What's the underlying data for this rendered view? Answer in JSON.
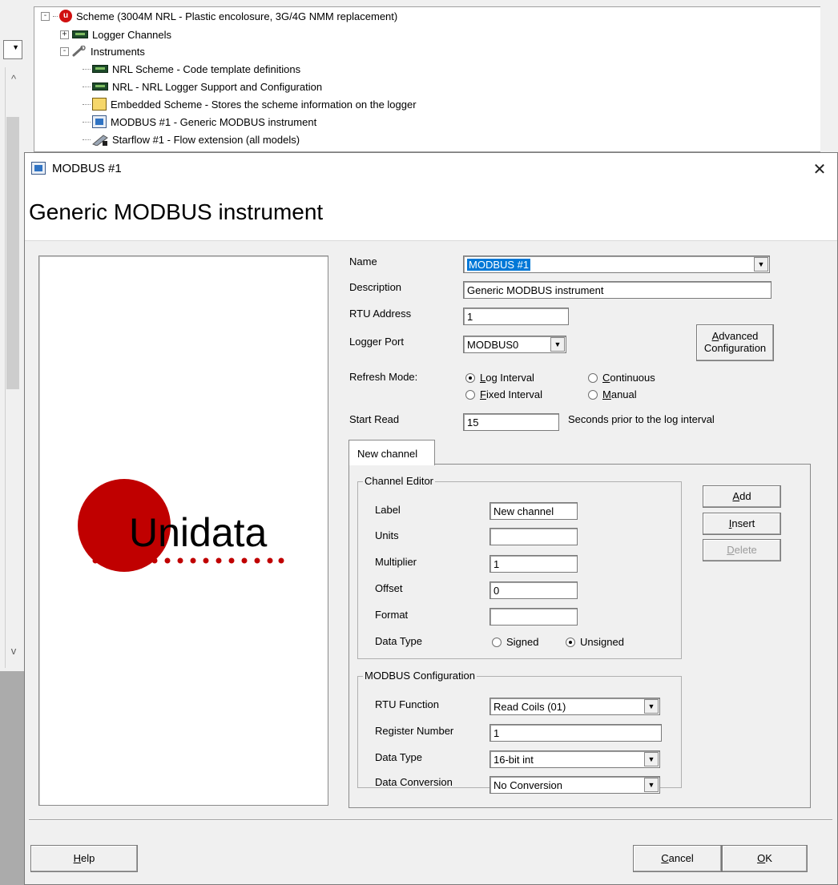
{
  "tree": {
    "root": "Scheme (3004M NRL - Plastic encolosure, 3G/4G NMM replacement)",
    "children": [
      {
        "label": "Logger Channels",
        "expander": "+"
      },
      {
        "label": "Instruments",
        "expander": "-"
      }
    ],
    "instruments": [
      "NRL Scheme - Code template definitions",
      "NRL - NRL Logger Support and Configuration",
      "Embedded Scheme - Stores the scheme information on the logger",
      "MODBUS #1 - Generic MODBUS instrument",
      "Starflow #1 - Flow extension (all models)"
    ],
    "root_icon_letter": "u"
  },
  "dialog": {
    "title": "MODBUS #1",
    "close_glyph": "✕",
    "heading": "Generic MODBUS instrument",
    "logo": {
      "text": "Unidata",
      "accent_color": "#c00000"
    },
    "fields": {
      "name_label": "Name",
      "name_value": "MODBUS #1",
      "description_label": "Description",
      "description_value": "Generic MODBUS instrument",
      "rtu_address_label": "RTU Address",
      "rtu_address_value": "1",
      "logger_port_label": "Logger Port",
      "logger_port_value": "MODBUS0",
      "refresh_mode_label": "Refresh Mode:",
      "start_read_label": "Start Read",
      "start_read_value": "15",
      "start_read_suffix": "Seconds prior to the log interval"
    },
    "advanced_button": {
      "line1_pre": "",
      "line1_u": "A",
      "line1_post": "dvanced",
      "line2": "Configuration"
    },
    "refresh_modes": {
      "log_interval": {
        "pre": "",
        "u": "L",
        "post": "og Interval",
        "selected": true
      },
      "continuous": {
        "pre": "",
        "u": "C",
        "post": "ontinuous",
        "selected": false
      },
      "fixed_interval": {
        "pre": "",
        "u": "F",
        "post": "ixed Interval",
        "selected": false
      },
      "manual": {
        "pre": "",
        "u": "M",
        "post": "anual",
        "selected": false
      }
    },
    "tab_label": "New channel",
    "channel_editor": {
      "title": "Channel Editor",
      "label_label": "Label",
      "label_value": "New channel",
      "units_label": "Units",
      "units_value": "",
      "multiplier_label": "Multiplier",
      "multiplier_value": "1",
      "offset_label": "Offset",
      "offset_value": "0",
      "format_label": "Format",
      "format_value": "",
      "data_type_label": "Data Type",
      "signed_label": "Signed",
      "unsigned_label": "Unsigned",
      "data_type_selected": "Unsigned"
    },
    "side_buttons": {
      "add": {
        "u": "A",
        "post": "dd"
      },
      "insert": {
        "u": "I",
        "post": "nsert"
      },
      "delete": {
        "u": "D",
        "post": "elete",
        "disabled": true
      }
    },
    "modbus_config": {
      "title": "MODBUS Configuration",
      "rtu_function_label": "RTU Function",
      "rtu_function_value": "Read Coils (01)",
      "register_number_label": "Register Number",
      "register_number_value": "1",
      "data_type_label": "Data Type",
      "data_type_value": "16-bit int",
      "data_conversion_label": "Data Conversion",
      "data_conversion_value": "No Conversion"
    },
    "footer": {
      "help": {
        "u": "H",
        "post": "elp"
      },
      "cancel": {
        "u": "C",
        "post": "ancel"
      },
      "ok": {
        "u": "O",
        "post": "K"
      }
    }
  }
}
